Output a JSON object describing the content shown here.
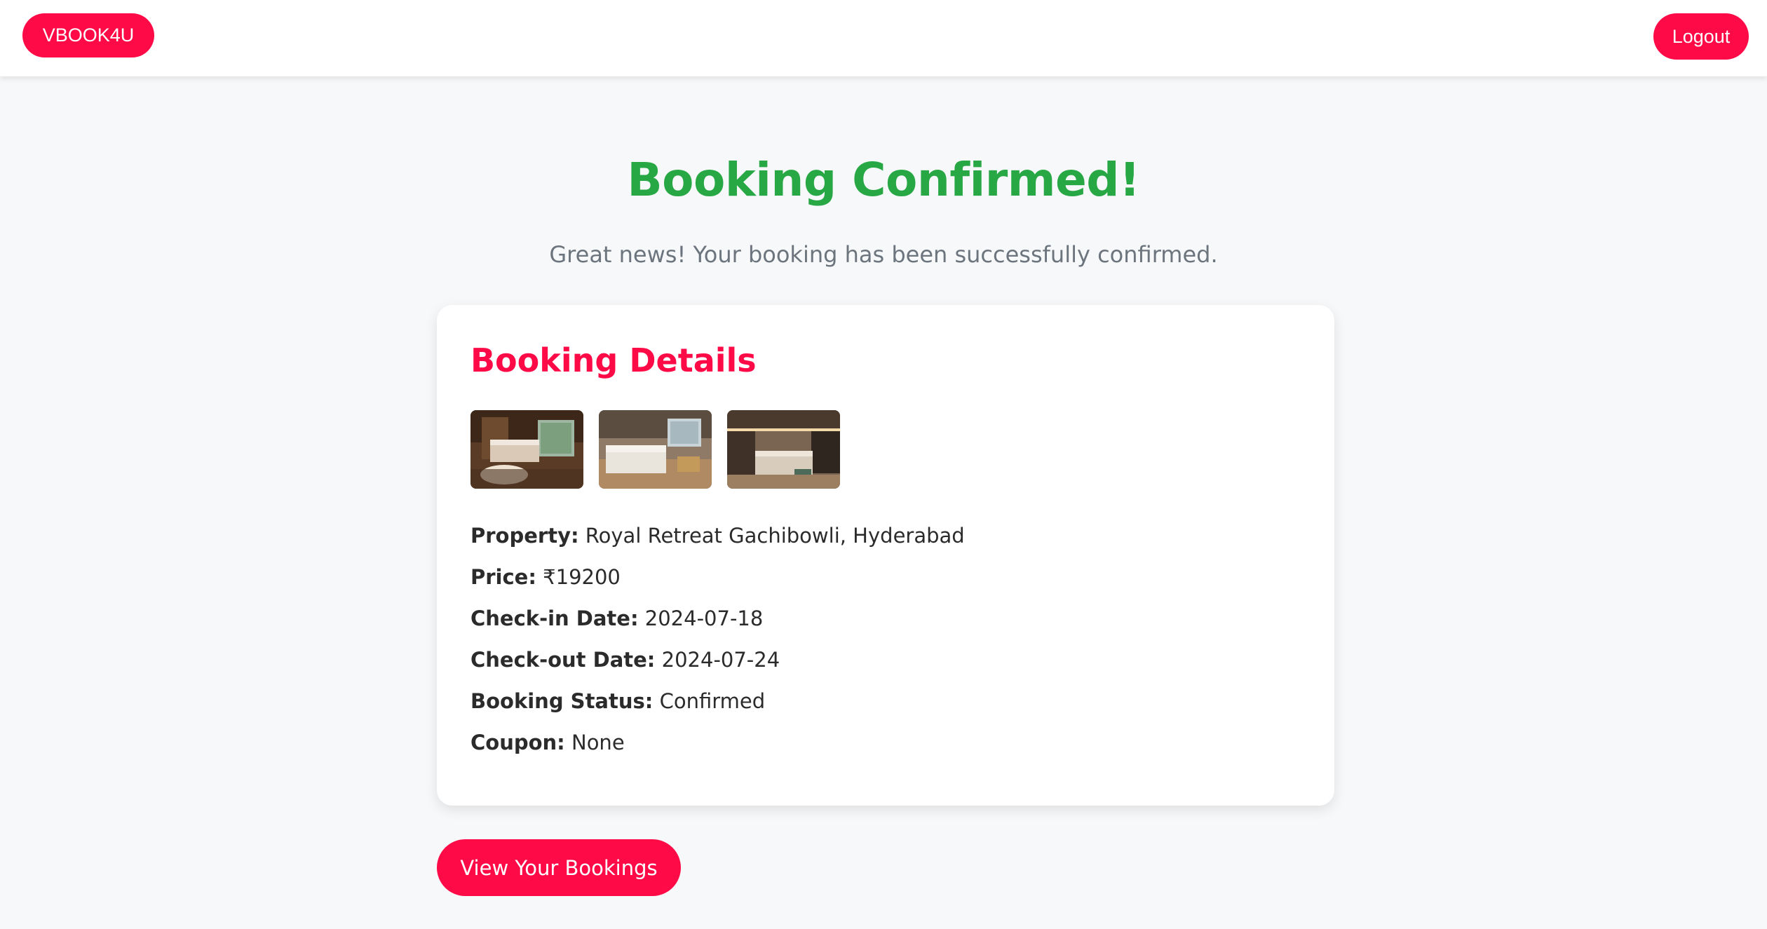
{
  "nav": {
    "brand_label": "VBOOK4U",
    "logout_label": "Logout"
  },
  "confirmation": {
    "title": "Booking Confirmed!",
    "message": "Great news! Your booking has been successfully confirmed."
  },
  "details": {
    "title": "Booking Details",
    "images": [
      {
        "description": "hotel-room-photo-1"
      },
      {
        "description": "hotel-room-photo-2"
      },
      {
        "description": "hotel-room-photo-3"
      }
    ],
    "rows": [
      {
        "label": "Property:",
        "value": "Royal Retreat Gachibowli, Hyderabad"
      },
      {
        "label": "Price:",
        "value": "₹19200"
      },
      {
        "label": "Check-in Date:",
        "value": "2024-07-18"
      },
      {
        "label": "Check-out Date:",
        "value": "2024-07-24"
      },
      {
        "label": "Booking Status:",
        "value": "Confirmed"
      },
      {
        "label": "Coupon:",
        "value": "None"
      }
    ]
  },
  "actions": {
    "view_bookings_label": "View Your Bookings"
  },
  "colors": {
    "accent": "#fe0a47",
    "success": "#28a745",
    "muted_text": "#6c757d",
    "background": "#f7f8fa"
  }
}
